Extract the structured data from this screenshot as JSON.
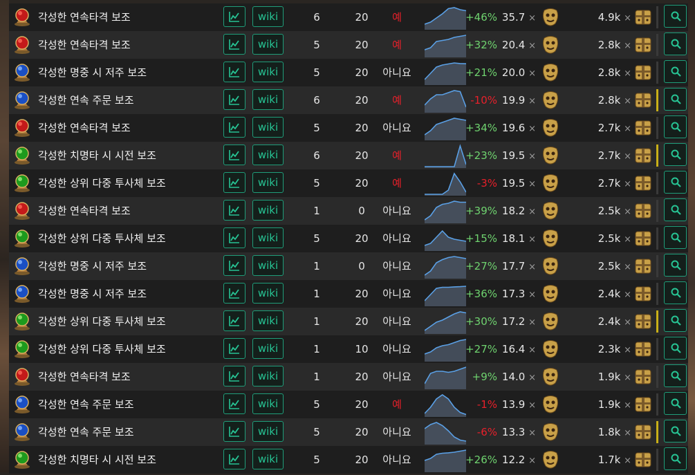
{
  "colors": {
    "accent": "#27c494",
    "positive": "#6fd36f",
    "negative": "#e8202a",
    "highlight_bar": "#c9b018"
  },
  "labels": {
    "wiki": "wiki",
    "times": "×"
  },
  "icons": {
    "chart": "chart-line-icon",
    "search": "search-icon",
    "ratio_currency": "mask-currency-icon",
    "price_currency": "chest-currency-icon"
  },
  "rows": [
    {
      "name": "각성한 연속타격 보조",
      "gem_color": "red",
      "level": "6",
      "quality": "20",
      "corrupted": "예",
      "corrupted_flag": true,
      "trend": [
        0.2,
        0.3,
        0.5,
        0.7,
        0.95,
        1,
        0.9,
        0.85
      ],
      "change": "+46%",
      "change_sign": "pos",
      "ratio": "35.7",
      "price": "4.9k",
      "highlight": false
    },
    {
      "name": "각성한 연속타격 보조",
      "gem_color": "red",
      "level": "5",
      "quality": "20",
      "corrupted": "예",
      "corrupted_flag": true,
      "trend": [
        0.3,
        0.4,
        0.7,
        0.75,
        0.8,
        0.9,
        0.95,
        1
      ],
      "change": "+32%",
      "change_sign": "pos",
      "ratio": "20.4",
      "price": "2.8k",
      "highlight": false
    },
    {
      "name": "각성한 명중 시 저주 보조",
      "gem_color": "blue",
      "level": "5",
      "quality": "20",
      "corrupted": "아니요",
      "corrupted_flag": false,
      "trend": [
        0.2,
        0.5,
        0.8,
        0.9,
        0.95,
        1,
        0.97,
        0.96
      ],
      "change": "+21%",
      "change_sign": "pos",
      "ratio": "20.0",
      "price": "2.8k",
      "highlight": false
    },
    {
      "name": "각성한 연속 주문 보조",
      "gem_color": "blue",
      "level": "6",
      "quality": "20",
      "corrupted": "예",
      "corrupted_flag": true,
      "trend": [
        0.3,
        0.6,
        0.8,
        0.8,
        0.9,
        1,
        0.95,
        0.2
      ],
      "change": "-10%",
      "change_sign": "neg",
      "ratio": "19.9",
      "price": "2.8k",
      "highlight": true
    },
    {
      "name": "각성한 연속타격 보조",
      "gem_color": "red",
      "level": "5",
      "quality": "20",
      "corrupted": "아니요",
      "corrupted_flag": false,
      "trend": [
        0.2,
        0.4,
        0.7,
        0.8,
        0.9,
        1,
        0.95,
        0.9
      ],
      "change": "+34%",
      "change_sign": "pos",
      "ratio": "19.6",
      "price": "2.7k",
      "highlight": false
    },
    {
      "name": "각성한 치명타 시 시전 보조",
      "gem_color": "green",
      "level": "6",
      "quality": "20",
      "corrupted": "예",
      "corrupted_flag": true,
      "trend": [
        0,
        0,
        0,
        0,
        0,
        0,
        1,
        0.1
      ],
      "change": "+23%",
      "change_sign": "pos",
      "ratio": "19.5",
      "price": "2.7k",
      "highlight": true
    },
    {
      "name": "각성한 상위 다중 투사체 보조",
      "gem_color": "green",
      "level": "5",
      "quality": "20",
      "corrupted": "예",
      "corrupted_flag": true,
      "trend": [
        0,
        0,
        0,
        0,
        0.2,
        1,
        0.6,
        0.1
      ],
      "change": "-3%",
      "change_sign": "neg",
      "ratio": "19.5",
      "price": "2.7k",
      "highlight": false
    },
    {
      "name": "각성한 연속타격 보조",
      "gem_color": "red",
      "level": "1",
      "quality": "0",
      "corrupted": "아니요",
      "corrupted_flag": false,
      "trend": [
        0.1,
        0.3,
        0.7,
        0.85,
        0.9,
        1,
        0.95,
        0.95
      ],
      "change": "+39%",
      "change_sign": "pos",
      "ratio": "18.2",
      "price": "2.5k",
      "highlight": false
    },
    {
      "name": "각성한 상위 다중 투사체 보조",
      "gem_color": "green",
      "level": "5",
      "quality": "20",
      "corrupted": "아니요",
      "corrupted_flag": false,
      "trend": [
        0.2,
        0.3,
        0.6,
        0.9,
        0.6,
        0.5,
        0.45,
        0.4
      ],
      "change": "+15%",
      "change_sign": "pos",
      "ratio": "18.1",
      "price": "2.5k",
      "highlight": false
    },
    {
      "name": "각성한 명중 시 저주 보조",
      "gem_color": "blue",
      "level": "1",
      "quality": "0",
      "corrupted": "아니요",
      "corrupted_flag": false,
      "trend": [
        0.1,
        0.3,
        0.7,
        0.85,
        0.95,
        1,
        0.95,
        0.9
      ],
      "change": "+27%",
      "change_sign": "pos",
      "ratio": "17.7",
      "price": "2.5k",
      "highlight": false
    },
    {
      "name": "각성한 명중 시 저주 보조",
      "gem_color": "blue",
      "level": "1",
      "quality": "20",
      "corrupted": "아니요",
      "corrupted_flag": false,
      "trend": [
        0.2,
        0.5,
        0.8,
        0.85,
        0.85,
        0.87,
        0.88,
        0.9
      ],
      "change": "+36%",
      "change_sign": "pos",
      "ratio": "17.3",
      "price": "2.4k",
      "highlight": false
    },
    {
      "name": "각성한 상위 다중 투사체 보조",
      "gem_color": "green",
      "level": "1",
      "quality": "20",
      "corrupted": "아니요",
      "corrupted_flag": false,
      "trend": [
        0.1,
        0.3,
        0.5,
        0.6,
        0.75,
        0.9,
        1,
        0.95
      ],
      "change": "+30%",
      "change_sign": "pos",
      "ratio": "17.2",
      "price": "2.4k",
      "highlight": true
    },
    {
      "name": "각성한 상위 다중 투사체 보조",
      "gem_color": "green",
      "level": "1",
      "quality": "10",
      "corrupted": "아니요",
      "corrupted_flag": false,
      "trend": [
        0.3,
        0.4,
        0.6,
        0.7,
        0.75,
        0.85,
        0.95,
        1
      ],
      "change": "+27%",
      "change_sign": "pos",
      "ratio": "16.4",
      "price": "2.3k",
      "highlight": false
    },
    {
      "name": "각성한 연속타격 보조",
      "gem_color": "red",
      "level": "1",
      "quality": "20",
      "corrupted": "아니요",
      "corrupted_flag": false,
      "trend": [
        0.2,
        0.7,
        0.8,
        0.8,
        0.75,
        0.8,
        0.9,
        1
      ],
      "change": "+9%",
      "change_sign": "pos",
      "ratio": "14.0",
      "price": "1.9k",
      "highlight": false
    },
    {
      "name": "각성한 연속 주문 보조",
      "gem_color": "blue",
      "level": "5",
      "quality": "20",
      "corrupted": "예",
      "corrupted_flag": true,
      "trend": [
        0.1,
        0.4,
        0.8,
        1,
        0.8,
        0.4,
        0.15,
        0.05
      ],
      "change": "-1%",
      "change_sign": "neg",
      "ratio": "13.9",
      "price": "1.9k",
      "highlight": false
    },
    {
      "name": "각성한 연속 주문 보조",
      "gem_color": "blue",
      "level": "5",
      "quality": "20",
      "corrupted": "아니요",
      "corrupted_flag": false,
      "trend": [
        0.7,
        0.9,
        1,
        0.85,
        0.6,
        0.3,
        0.15,
        0.1
      ],
      "change": "-6%",
      "change_sign": "neg",
      "ratio": "13.3",
      "price": "1.8k",
      "highlight": true
    },
    {
      "name": "각성한 치명타 시 시전 보조",
      "gem_color": "green",
      "level": "5",
      "quality": "20",
      "corrupted": "아니요",
      "corrupted_flag": false,
      "trend": [
        0.5,
        0.6,
        0.8,
        0.85,
        0.87,
        0.9,
        0.95,
        1
      ],
      "change": "+26%",
      "change_sign": "pos",
      "ratio": "12.2",
      "price": "1.7k",
      "highlight": false
    }
  ]
}
